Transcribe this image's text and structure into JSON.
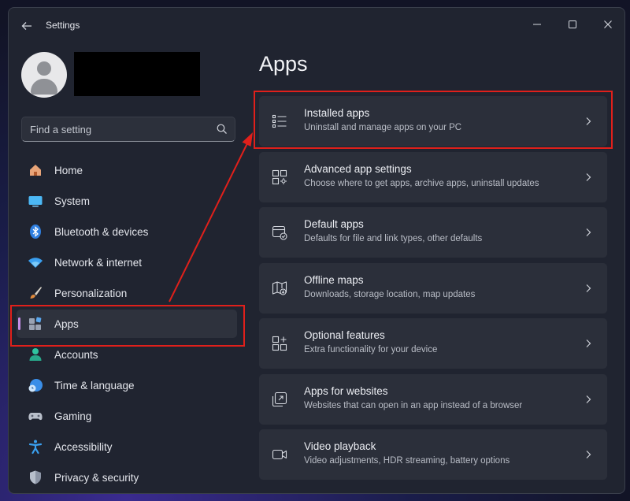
{
  "window": {
    "title": "Settings",
    "controls": {
      "minimize": "–",
      "maximize": "☐",
      "close": "✕"
    }
  },
  "search": {
    "placeholder": "Find a setting"
  },
  "sidebar": {
    "items": [
      {
        "label": "Home",
        "icon": "home-icon"
      },
      {
        "label": "System",
        "icon": "system-icon"
      },
      {
        "label": "Bluetooth & devices",
        "icon": "bluetooth-icon"
      },
      {
        "label": "Network & internet",
        "icon": "wifi-icon"
      },
      {
        "label": "Personalization",
        "icon": "brush-icon"
      },
      {
        "label": "Apps",
        "icon": "apps-icon",
        "selected": true
      },
      {
        "label": "Accounts",
        "icon": "accounts-icon"
      },
      {
        "label": "Time & language",
        "icon": "clock-globe-icon"
      },
      {
        "label": "Gaming",
        "icon": "gamepad-icon"
      },
      {
        "label": "Accessibility",
        "icon": "accessibility-icon"
      },
      {
        "label": "Privacy & security",
        "icon": "shield-icon"
      }
    ]
  },
  "main": {
    "title": "Apps",
    "cards": [
      {
        "title": "Installed apps",
        "desc": "Uninstall and manage apps on your PC",
        "icon": "list-icon"
      },
      {
        "title": "Advanced app settings",
        "desc": "Choose where to get apps, archive apps, uninstall updates",
        "icon": "app-settings-icon"
      },
      {
        "title": "Default apps",
        "desc": "Defaults for file and link types, other defaults",
        "icon": "default-apps-icon"
      },
      {
        "title": "Offline maps",
        "desc": "Downloads, storage location, map updates",
        "icon": "map-icon"
      },
      {
        "title": "Optional features",
        "desc": "Extra functionality for your device",
        "icon": "optional-features-icon"
      },
      {
        "title": "Apps for websites",
        "desc": "Websites that can open in an app instead of a browser",
        "icon": "open-in-app-icon"
      },
      {
        "title": "Video playback",
        "desc": "Video adjustments, HDR streaming, battery options",
        "icon": "video-icon"
      }
    ]
  },
  "colors": {
    "annotation": "#e0201b",
    "accent": "#c48ee6",
    "window_bg": "#202430",
    "card_bg": "#2b2f3a"
  }
}
